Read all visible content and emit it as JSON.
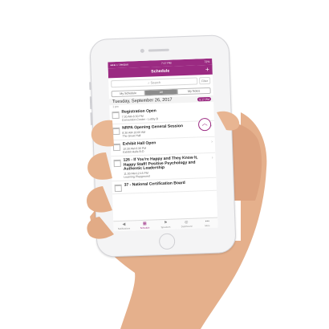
{
  "status": {
    "carrier": "●●●○○ Verizon",
    "time": "7:17 PM",
    "battery": "72%"
  },
  "nav": {
    "title": "Schedule",
    "add": "+"
  },
  "search": {
    "placeholder": "Search",
    "filter": "Filter"
  },
  "segments": [
    {
      "label": "My Schedule"
    },
    {
      "label": "All"
    },
    {
      "label": "My Notes"
    }
  ],
  "date": "Tuesday, September 26, 2017",
  "time_badge": "5:17 PM",
  "pm_label": "1 pm",
  "items": [
    {
      "title": "Registration Open",
      "time": "7:30 AM-6:30 PM",
      "place": "Convention Center - Lobby B"
    },
    {
      "title": "NRPA Opening General Session",
      "time": "8:30 AM-10:00 AM",
      "place": "The Great Hall"
    },
    {
      "title": "Exhibit Hall Open",
      "time": "10:30 AM-6:30 PM",
      "place": "Exhibit Halls B-D"
    },
    {
      "title": "126 - If You're Happy and They Know It, Happy Staff! Positive Psychology and Authentic Leadership",
      "time": "11:00 AM-12:15 PM",
      "place": "Learning Playground"
    },
    {
      "title": "37 - National Certification Board",
      "time": "",
      "place": ""
    }
  ],
  "tabs": [
    {
      "label": "Notifications",
      "icon": "◀"
    },
    {
      "label": "Schedule",
      "icon": "▦"
    },
    {
      "label": "Speakers",
      "icon": "⚑"
    },
    {
      "label": "Dashboard",
      "icon": "◎"
    },
    {
      "label": "More",
      "icon": "•••"
    }
  ],
  "colors": {
    "accent": "#9b2a82",
    "skin": "#e8b894"
  }
}
